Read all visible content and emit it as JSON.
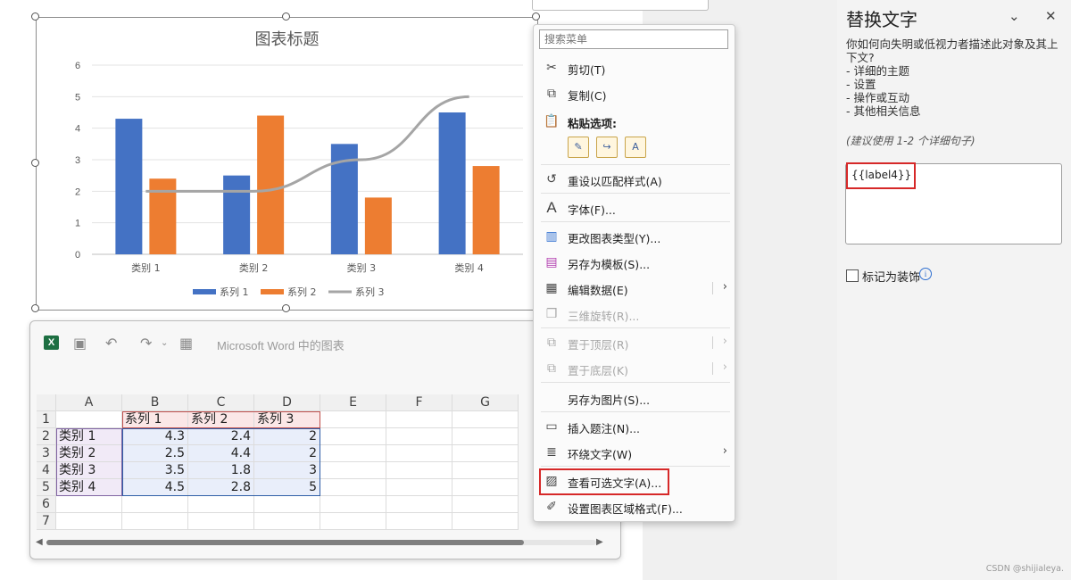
{
  "chart": {
    "title": "图表标题",
    "y_ticks": [
      "0",
      "1",
      "2",
      "3",
      "4",
      "5",
      "6"
    ],
    "categories": [
      "类别 1",
      "类别 2",
      "类别 3",
      "类别 4"
    ],
    "legend": [
      "系列 1",
      "系列 2",
      "系列 3"
    ]
  },
  "chart_data": {
    "type": "bar",
    "title": "图表标题",
    "categories": [
      "类别 1",
      "类别 2",
      "类别 3",
      "类别 4"
    ],
    "series": [
      {
        "name": "系列 1",
        "type": "bar",
        "color": "#4472c4",
        "values": [
          4.3,
          2.5,
          3.5,
          4.5
        ]
      },
      {
        "name": "系列 2",
        "type": "bar",
        "color": "#ed7d31",
        "values": [
          2.4,
          4.4,
          1.8,
          2.8
        ]
      },
      {
        "name": "系列 3",
        "type": "line",
        "color": "#a5a5a5",
        "values": [
          2,
          2,
          3,
          5
        ]
      }
    ],
    "ylim": [
      0,
      6
    ],
    "grid": true,
    "legend_position": "bottom"
  },
  "excel": {
    "title": "Microsoft Word 中的图表",
    "columns": [
      "A",
      "B",
      "C",
      "D",
      "E",
      "F",
      "G"
    ],
    "row_numbers": [
      "1",
      "2",
      "3",
      "4",
      "5",
      "6",
      "7"
    ],
    "rows": [
      [
        "",
        "系列 1",
        "系列 2",
        "系列 3"
      ],
      [
        "类别 1",
        "4.3",
        "2.4",
        "2"
      ],
      [
        "类别 2",
        "2.5",
        "4.4",
        "2"
      ],
      [
        "类别 3",
        "3.5",
        "1.8",
        "3"
      ],
      [
        "类别 4",
        "4.5",
        "2.8",
        "5"
      ]
    ]
  },
  "menu": {
    "search_placeholder": "搜索菜单",
    "cut": "剪切(T)",
    "copy": "复制(C)",
    "paste_options": "粘贴选项:",
    "reset_style": "重设以匹配样式(A)",
    "font": "字体(F)...",
    "change_chart_type": "更改图表类型(Y)...",
    "save_as_template": "另存为模板(S)...",
    "edit_data": "编辑数据(E)",
    "rotation_3d": "三维旋转(R)...",
    "bring_to_front": "置于顶层(R)",
    "send_to_back": "置于底层(K)",
    "save_as_picture": "另存为图片(S)...",
    "insert_caption": "插入题注(N)...",
    "wrap_text": "环绕文字(W)",
    "view_alt_text": "查看可选文字(A)...",
    "format_chart_area": "设置图表区域格式(F)..."
  },
  "pane": {
    "title": "替换文字",
    "description_line1": "你如何向失明或低视力者描述此对象及其上下文?",
    "bullets": [
      "- 详细的主题",
      "- 设置",
      "- 操作或互动",
      "- 其他相关信息"
    ],
    "hint": "(建议使用 1-2 个详细句子)",
    "alt_text_value": "{{label4}}",
    "decorative_label": "标记为装饰"
  },
  "watermark": "CSDN @shijialeya."
}
